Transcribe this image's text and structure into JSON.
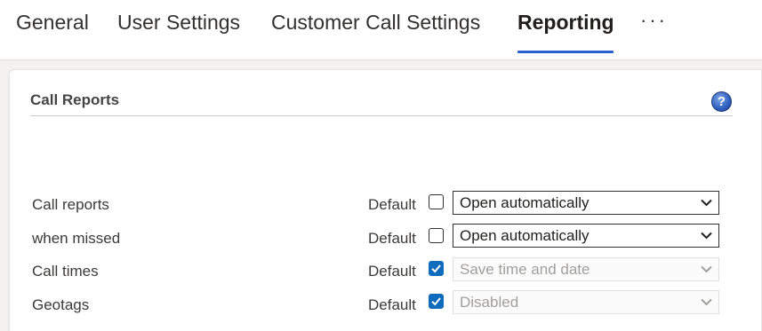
{
  "tabs": [
    {
      "label": "General",
      "active": false
    },
    {
      "label": "User Settings",
      "active": false
    },
    {
      "label": "Customer Call Settings",
      "active": false
    },
    {
      "label": "Reporting",
      "active": true
    }
  ],
  "more_label": "···",
  "section": {
    "title": "Call Reports",
    "help_icon": "question-mark-icon",
    "help_glyph": "?"
  },
  "rows": [
    {
      "label": "Call reports",
      "default_label": "Default",
      "default_checked": false,
      "select_value": "Open automatically",
      "select_disabled": false
    },
    {
      "label": "when missed",
      "default_label": "Default",
      "default_checked": false,
      "select_value": "Open automatically",
      "select_disabled": false
    },
    {
      "label": "Call times",
      "default_label": "Default",
      "default_checked": true,
      "select_value": "Save time and date",
      "select_disabled": true
    },
    {
      "label": "Geotags",
      "default_label": "Default",
      "default_checked": true,
      "select_value": "Disabled",
      "select_disabled": true
    }
  ],
  "colors": {
    "accent": "#2b5fce",
    "checkbox_checked": "#0f6cbd",
    "disabled_text": "#a19f9d"
  }
}
